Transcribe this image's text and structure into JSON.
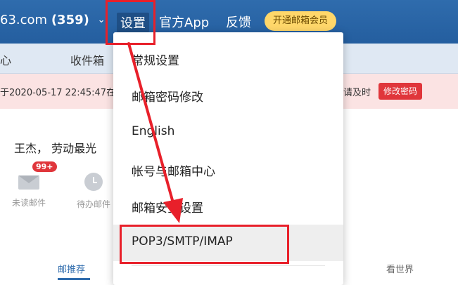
{
  "header": {
    "account_domain": "63.com",
    "account_count": "(359)",
    "settings_label": "设置",
    "app_label": "官方App",
    "feedback_label": "反馈",
    "vip_label": "开通邮箱会员"
  },
  "navstrip": {
    "left_partial": "心",
    "inbox_label": "收件箱"
  },
  "warning": {
    "text_left": "于2020-05-17 22:45:47在",
    "text_right": "请及时",
    "button_label": "修改密码"
  },
  "greeting": "王杰， 劳动最光",
  "stats": {
    "unread_badge": "99+",
    "unread_label": "未读邮件",
    "todo_label": "待办邮件"
  },
  "tabs": {
    "recommend": "邮推荐",
    "world": "看世界"
  },
  "menu": {
    "items": [
      {
        "label": "常规设置"
      },
      {
        "label": "邮箱密码修改"
      },
      {
        "label": "English"
      },
      {
        "label": "帐号与邮箱中心"
      },
      {
        "label": "邮箱安全设置"
      },
      {
        "label": "POP3/SMTP/IMAP"
      }
    ]
  },
  "colors": {
    "header_bg": "#2f6cad",
    "annotation": "#e8202a",
    "vip_bg": "#ffd76a"
  }
}
